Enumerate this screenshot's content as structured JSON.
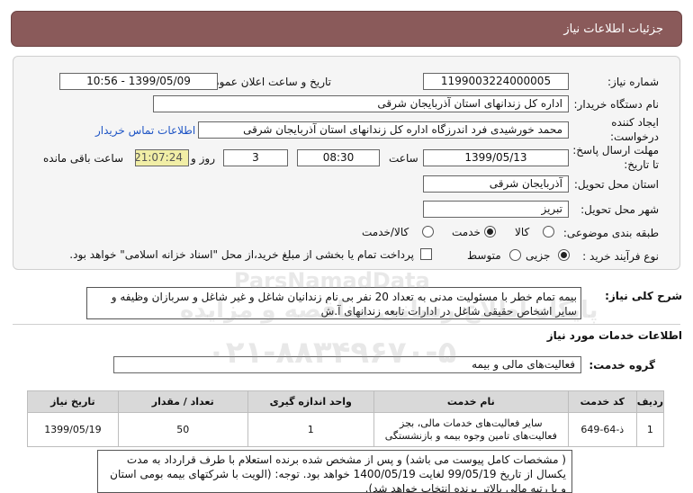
{
  "header": {
    "title": "جزئیات اطلاعات نیاز"
  },
  "form": {
    "need_number": {
      "label": "شماره نیاز:",
      "value": "1199003224000005"
    },
    "announce_datetime": {
      "label": "تاریخ و ساعت اعلان عمومی:",
      "value": "1399/05/09 - 10:56"
    },
    "buyer_org": {
      "label": "نام دستگاه خریدار:",
      "value": "اداره کل زندانهای استان آذربایجان شرقی"
    },
    "requester": {
      "label_line1": "ایجاد کننده",
      "label_line2": "درخواست:",
      "value": "محمد خورشیدی فرد اندرزگاه اداره کل زندانهای استان آذربایجان شرقی",
      "contact_link": "اطلاعات تماس خریدار"
    },
    "deadline": {
      "label_line1": "مهلت ارسال پاسخ:",
      "label_line2": "تا تاریخ:",
      "date": "1399/05/13",
      "time_label": "ساعت",
      "time": "08:30",
      "days": "3",
      "days_label": "روز و",
      "remaining": "21:07:24",
      "remaining_label": "ساعت باقی مانده"
    },
    "province": {
      "label": "استان محل تحویل:",
      "value": "آذربایجان شرقی"
    },
    "city": {
      "label": "شهر محل تحویل:",
      "value": "تبریز"
    },
    "category": {
      "label": "طبقه بندی موضوعی:",
      "options": [
        "کالا",
        "خدمت",
        "کالا/خدمت"
      ],
      "selected": "خدمت"
    },
    "process_type": {
      "label": "نوع فرآیند خرید :",
      "options": [
        "جزیی",
        "متوسط"
      ],
      "selected": "جزیی",
      "payment_note": "پرداخت تمام یا بخشی از مبلغ خرید،از محل \"اسناد خزانه اسلامی\" خواهد بود."
    }
  },
  "description": {
    "label": "شرح کلی نیاز:",
    "text": "بیمه تمام خطر با مسئولیت مدنی به تعداد 20 نفر بی نام زندانیان شاغل و غیر شاغل و سربازان وظیفه و سایر اشخاص حقیقی شاغل در ادارات تابعه زندانهای آ.ش"
  },
  "services": {
    "section_title": "اطلاعات خدمات مورد نیاز",
    "group_label": "گروه خدمت:",
    "group_value": "فعالیت‌های مالی و بیمه",
    "columns": [
      "ردیف",
      "کد خدمت",
      "نام خدمت",
      "واحد اندازه گیری",
      "تعداد / مقدار",
      "تاریخ نیاز"
    ],
    "rows": [
      {
        "row": "1",
        "code": "ذ-64-649",
        "name": "سایر فعالیت‌های خدمات مالی، بجز فعالیت‌های تامین وجوه بیمه و بازنشستگی",
        "unit": "1",
        "qty": "50",
        "date": "1399/05/19"
      }
    ]
  },
  "note": {
    "text": "( مشخصات کامل پیوست می باشد) و پس از مشخص شده برنده استعلام با طرف قرارداد به مدت یکسال از تاریخ 99/05/19 لغایت 1400/05/19 خواهد بود. توجه: (الویت با شرکتهای بیمه بومی استان و با رتبه مالی بالاتر برنده انتخاب خواهد شد)."
  },
  "watermark": {
    "brand": "ParsNamadData",
    "line1": "پایگاه اطلاع رسانی مناقصه و مزایده",
    "phone": "۰۲۱-۸۸۳۴۹۶۷۰-۵"
  },
  "colors": {
    "header_bg": "#8a5a5a",
    "link": "#1f55c5",
    "remaining_bg": "#f1eea6"
  }
}
